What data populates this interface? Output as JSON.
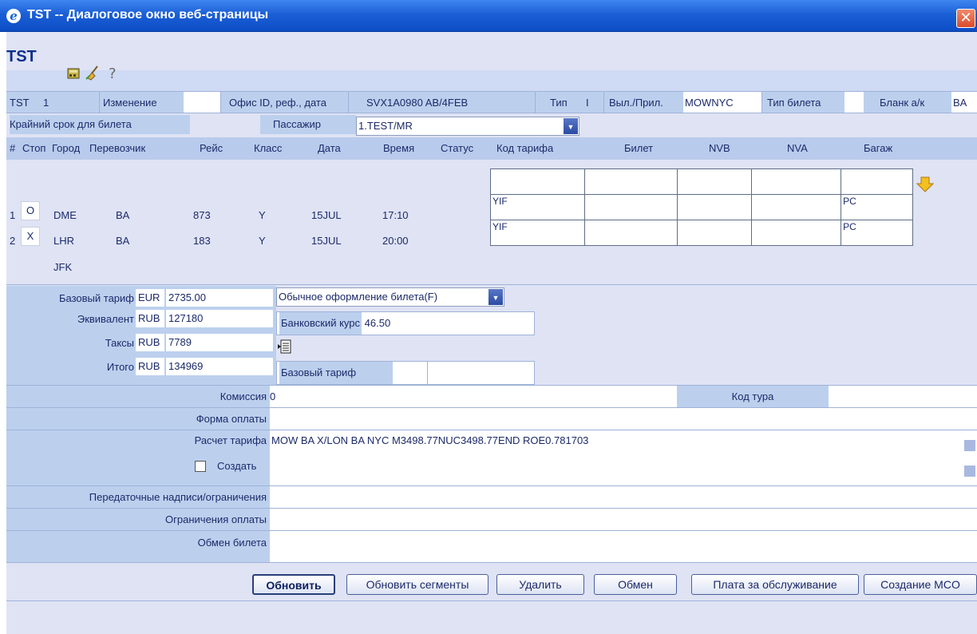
{
  "window": {
    "title": "TST -- Диалоговое окно веб-страницы",
    "close_icon": "close-icon",
    "ie_glyph": "e"
  },
  "app": {
    "title": "TST"
  },
  "toolbar": {
    "icons": [
      "calculator-icon",
      "broom-icon",
      "help-icon"
    ]
  },
  "header": {
    "tst_label": "TST",
    "tst_value": "1",
    "change_label": "Изменение",
    "office_label": "Офис ID, реф., дата",
    "office_value": "SVX1A0980 AB/4FEB",
    "type_label": "Тип",
    "type_value": "I",
    "route_label": "Выл./Прил.",
    "route_value": "MOWNYC",
    "ticket_type_label": "Тип билета",
    "blank_label": "Бланк а/к",
    "blank_value": "BA"
  },
  "row2": {
    "deadline_label": "Крайний срок для билета",
    "passenger_label": "Пассажир",
    "passenger_value": "1.TEST/MR"
  },
  "columns": [
    "#",
    "Стоп",
    "Город",
    "Перевозчик",
    "Рейс",
    "Класс",
    "Дата",
    "Время",
    "Статус",
    "Код тарифа",
    "Билет",
    "NVB",
    "NVA",
    "Багаж"
  ],
  "segments": [
    {
      "num": "1",
      "stop": "O",
      "city": "DME",
      "carrier": "BA",
      "flight": "873",
      "class": "Y",
      "date": "15JUL",
      "time": "17:10",
      "fare_code": "YIF",
      "baggage": "PC"
    },
    {
      "num": "2",
      "stop": "X",
      "city": "LHR",
      "carrier": "BA",
      "flight": "183",
      "class": "Y",
      "date": "15JUL",
      "time": "20:00",
      "fare_code": "YIF",
      "baggage": "PC"
    }
  ],
  "final_city": "JFK",
  "arrow_icon": "arrow-down-icon",
  "fares": {
    "base_label": "Базовый тариф",
    "base_cur": "EUR",
    "base_val": "2735.00",
    "equiv_label": "Эквивалент",
    "equiv_cur": "RUB",
    "equiv_val": "127180",
    "taxes_label": "Таксы",
    "taxes_cur": "RUB",
    "taxes_val": "7789",
    "total_label": "Итого",
    "total_cur": "RUB",
    "total_val": "134969",
    "issue_mode": "Обычное оформление билета(F)",
    "bank_rate_label": "Банковский курс",
    "bank_rate_val": "46.50",
    "tax_details_icon": "tax-details-icon",
    "base_fare2_label": "Базовый тариф"
  },
  "commission": {
    "label": "Комиссия",
    "value": "0",
    "tour_code_label": "Код тура"
  },
  "fields": {
    "payment_label": "Форма оплаты",
    "fare_calc_label": "Расчет тарифа",
    "fare_calc_value": "MOW BA X/LON BA NYC M3498.77NUC3498.77END ROE0.781703",
    "create_label": "Создать",
    "endorse_label": "Передаточные надписи/ограничения",
    "payment_restr_label": "Ограничения оплаты",
    "exchange_label": "Обмен билета"
  },
  "buttons": {
    "update": "Обновить",
    "update_segments": "Обновить сегменты",
    "delete": "Удалить",
    "exchange": "Обмен",
    "service_fee": "Плата за обслуживание",
    "create_mco": "Создание MCO"
  }
}
